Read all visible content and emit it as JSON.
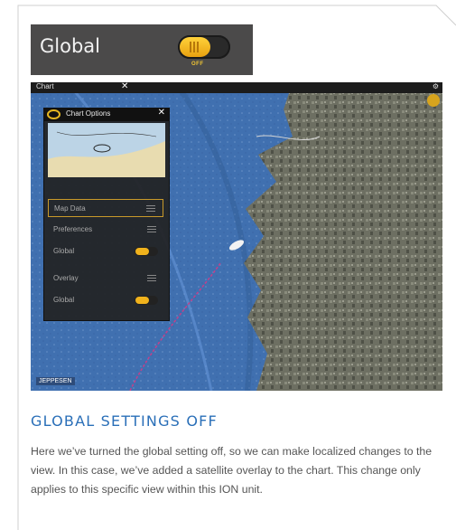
{
  "global_bar": {
    "label": "Global",
    "toggle_state": "OFF"
  },
  "screen": {
    "title_bar": {
      "title": "Chart",
      "close_glyph": "✕"
    },
    "panel": {
      "title": "Chart Options",
      "close_glyph": "✕",
      "items": [
        {
          "label": "Map Data",
          "control": "menu-icon",
          "selected": true
        },
        {
          "label": "Preferences",
          "control": "menu-icon"
        },
        {
          "label": "Global",
          "control": "toggle"
        },
        {
          "label": "Overlay",
          "control": "menu-icon"
        },
        {
          "label": "Global",
          "control": "toggle"
        }
      ]
    },
    "watermark": "JEPPESEN"
  },
  "caption": {
    "heading": "GLOBAL SETTINGS OFF",
    "body": "Here we’ve turned the global setting off, so we can make localized changes to the view. In this case, we’ve added a satellite overlay to the chart. This change only applies to this specific view within this ION unit."
  },
  "colors": {
    "accent": "#2a6fb8",
    "toggle": "#f0b21c",
    "water": "#3f6ca8"
  }
}
